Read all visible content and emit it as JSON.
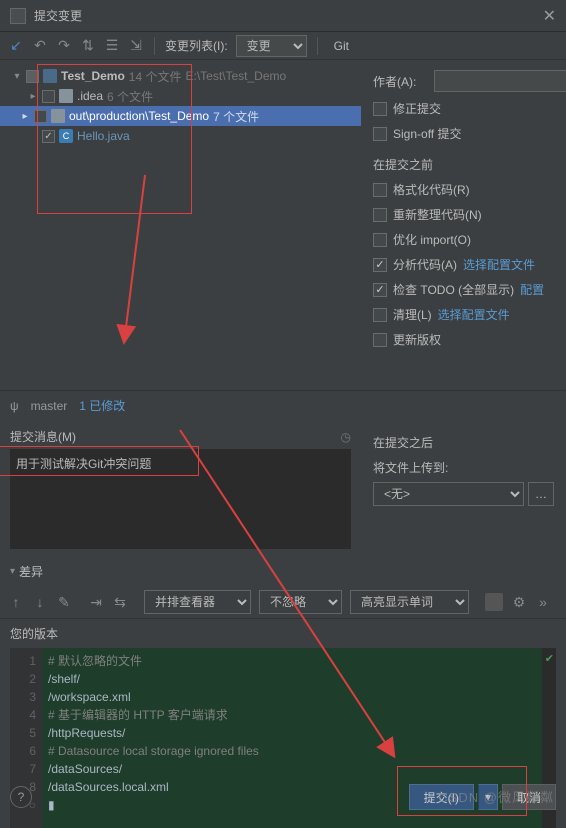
{
  "title": "提交变更",
  "toolbar": {
    "changelist_label": "变更列表(I):",
    "changelist_value": "变更",
    "git_label": "Git"
  },
  "tree": {
    "root": {
      "name": "Test_Demo",
      "meta": "14 个文件",
      "path": "E:\\Test\\Test_Demo"
    },
    "a": {
      "name": ".idea",
      "meta": "6 个文件"
    },
    "b": {
      "name": "out\\production\\Test_Demo",
      "meta": "7 个文件"
    },
    "c": {
      "name": "Hello.java"
    }
  },
  "branch": {
    "icon": "ψ",
    "name": "master",
    "changes": "1 已修改"
  },
  "msg_label": "提交消息(M)",
  "msg_text": "用于测试解决Git冲突问题",
  "right": {
    "author": "作者(A):",
    "amend": "修正提交",
    "signoff": "Sign-off 提交",
    "before": "在提交之前",
    "reformat": "格式化代码(R)",
    "rearrange": "重新整理代码(N)",
    "optimize": "优化 import(O)",
    "analyze": "分析代码(A)",
    "analyze_link": "选择配置文件",
    "todo": "检查 TODO (全部显示)",
    "todo_link": "配置",
    "cleanup": "清理(L)",
    "cleanup_link": "选择配置文件",
    "copyright": "更新版权",
    "after": "在提交之后",
    "upload": "将文件上传到:",
    "upload_value": "<无>"
  },
  "diff": {
    "label": "差异",
    "viewer": "并排查看器",
    "ignore": "不忽略",
    "highlight": "高亮显示单词",
    "yourver": "您的版本"
  },
  "code": {
    "l1": "# 默认忽略的文件",
    "l2": "/shelf/",
    "l3": "/workspace.xml",
    "l4": "# 基于编辑器的 HTTP 客户端请求",
    "l5": "/httpRequests/",
    "l6": "# Datasource local storage ignored files",
    "l7": "/dataSources/",
    "l8": "/dataSources.local.xml"
  },
  "footer": {
    "commit": "提交(I)",
    "cancel": "取消"
  },
  "watermark": "CSDN @微风粼粼"
}
